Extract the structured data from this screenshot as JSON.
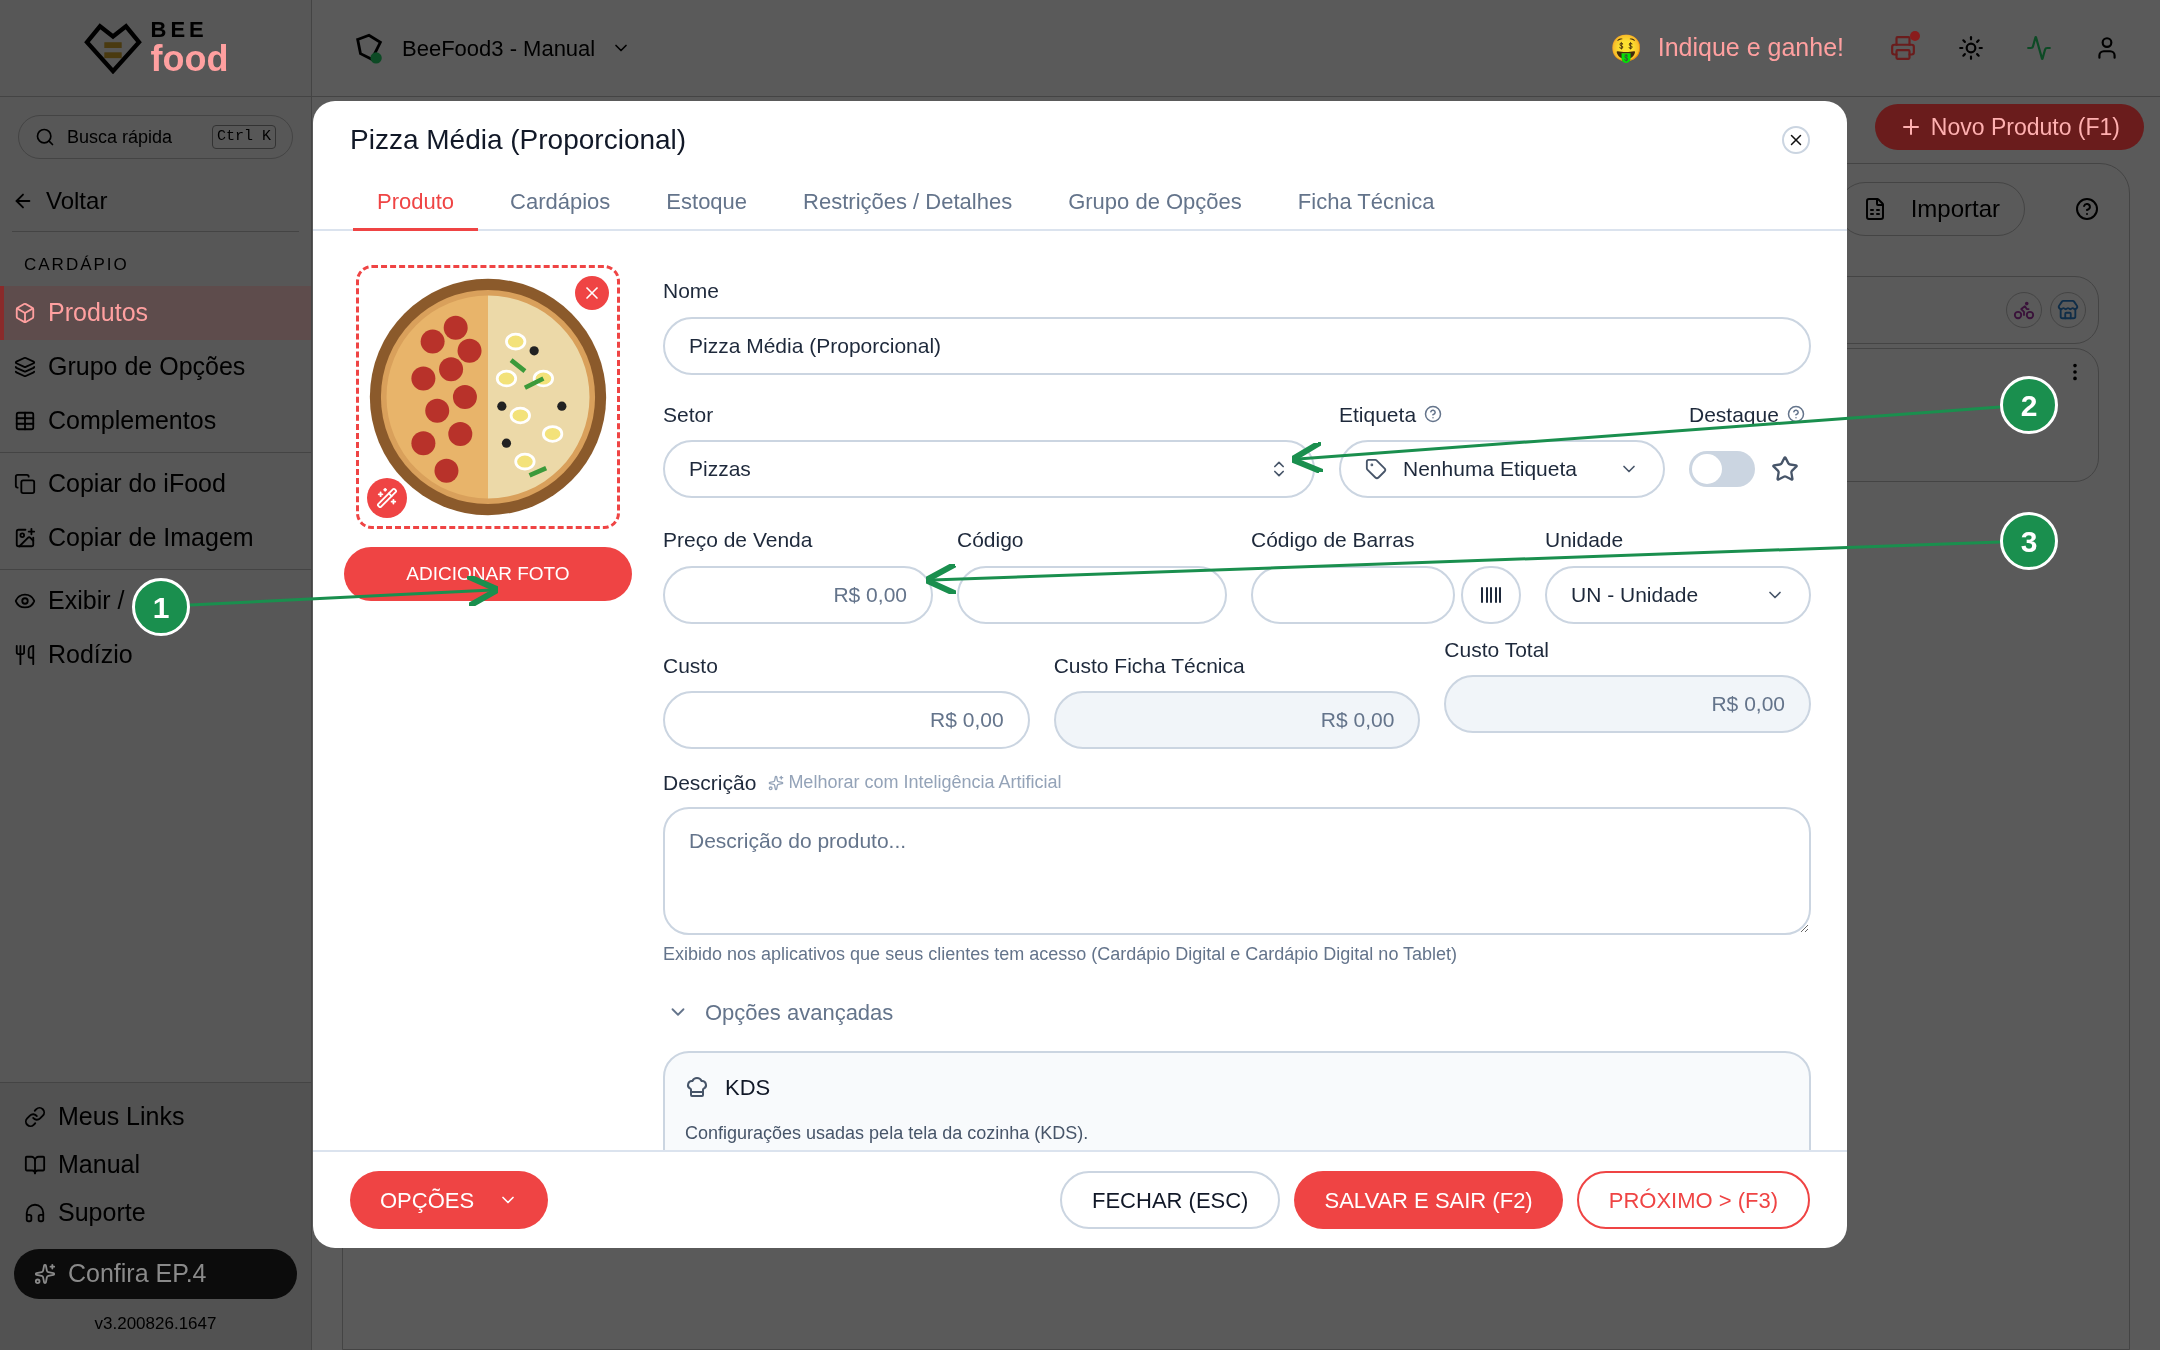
{
  "sidebar": {
    "logo": {
      "line1": "BEE",
      "line2": "food"
    },
    "search": {
      "placeholder": "Busca rápida",
      "shortcut": "Ctrl K"
    },
    "back": "Voltar",
    "section": "CARDÁPIO",
    "nav_groups": [
      [
        {
          "label": "Produtos",
          "selected": true
        },
        {
          "label": "Grupo de Opções",
          "selected": false
        },
        {
          "label": "Complementos",
          "selected": false
        }
      ],
      [
        {
          "label": "Copiar do iFood",
          "selected": false
        },
        {
          "label": "Copiar de Imagem",
          "selected": false
        }
      ],
      [
        {
          "label": "Exibir /",
          "selected": false
        },
        {
          "label": "Rodízio",
          "selected": false
        }
      ]
    ],
    "links": [
      "Meus Links",
      "Manual",
      "Suporte"
    ],
    "promo": "Confira EP.4",
    "version": "v3.200826.1647"
  },
  "topbar": {
    "workspace": "BeeFood3 - Manual",
    "referral_emoji": "🤑",
    "referral": "Indique e ganhe!",
    "printer_alert": true
  },
  "background": {
    "new_product": "Novo Produto (F1)",
    "import": "Importar"
  },
  "modal": {
    "title": "Pizza Média (Proporcional)",
    "tabs": [
      {
        "label": "Produto",
        "selected": true
      },
      {
        "label": "Cardápios",
        "selected": false
      },
      {
        "label": "Estoque",
        "selected": false
      },
      {
        "label": "Restrições / Detalhes",
        "selected": false
      },
      {
        "label": "Grupo de Opções",
        "selected": false
      },
      {
        "label": "Ficha Técnica",
        "selected": false
      }
    ],
    "photo": {
      "kind": "picture",
      "add_button": "ADICIONAR FOTO"
    },
    "nome": {
      "label": "Nome",
      "value": "Pizza Média (Proporcional)"
    },
    "setor": {
      "label": "Setor",
      "value": "Pizzas"
    },
    "etiqueta": {
      "label": "Etiqueta",
      "value": "Nenhuma Etiqueta"
    },
    "destaque": {
      "label": "Destaque",
      "on": false
    },
    "row_prices": [
      {
        "label": "Preço de Venda",
        "value": "R$ 0,00"
      },
      {
        "label": "Código"
      },
      {
        "label": "Código de Barras"
      }
    ],
    "unidade": {
      "label": "Unidade",
      "value": "UN - Unidade"
    },
    "costs": [
      {
        "label": "Custo",
        "value": "R$ 0,00",
        "disabled": false
      },
      {
        "label": "Custo Ficha Técnica",
        "value": "R$ 0,00",
        "disabled": true
      },
      {
        "label": "Custo Total",
        "value": "R$ 0,00",
        "disabled": true
      }
    ],
    "descricao": {
      "label": "Descrição",
      "ai_link": "Melhorar com Inteligência Artificial",
      "placeholder": "Descrição do produto...",
      "help": "Exibido nos aplicativos que seus clientes tem acesso (Cardápio Digital e Cardápio Digital no Tablet)"
    },
    "advanced": {
      "label": "Opções avançadas",
      "expanded": true
    },
    "kds": {
      "title": "KDS",
      "description": "Configurações usadas pela tela da cozinha (KDS)."
    },
    "footer": {
      "options": "OPÇÕES",
      "buttons": [
        {
          "label": "FECHAR (ESC)",
          "kind": "outline"
        },
        {
          "label": "SALVAR E SAIR (F2)",
          "kind": "primary"
        },
        {
          "label": "PRÓXIMO > (F3)",
          "kind": "danger-outline"
        }
      ]
    }
  },
  "callouts": [
    {
      "label": "1"
    },
    {
      "label": "2"
    },
    {
      "label": "3"
    }
  ]
}
